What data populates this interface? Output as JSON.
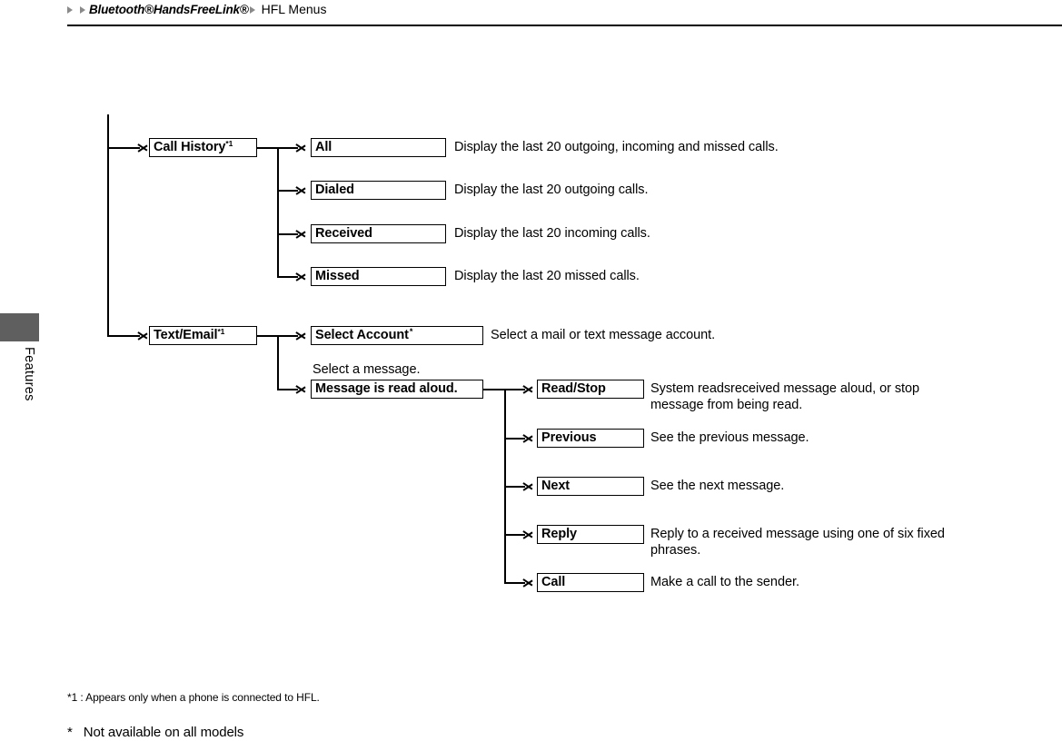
{
  "header": {
    "breadcrumb": {
      "item1": "Bluetooth®HandsFreeLink®",
      "item2": "HFL Menus"
    }
  },
  "sidebar": {
    "tab_label": "Features"
  },
  "flow": {
    "level1": [
      {
        "label": "Call History",
        "footnote": "*1"
      },
      {
        "label": "Text/Email",
        "footnote": "*1"
      }
    ],
    "call_history_children": [
      {
        "label": "All",
        "description": "Display the last 20 outgoing, incoming and missed calls."
      },
      {
        "label": "Dialed",
        "description": "Display the last 20 outgoing calls."
      },
      {
        "label": "Received",
        "description": "Display the last 20 incoming calls."
      },
      {
        "label": "Missed",
        "description": "Display the last 20 missed calls."
      }
    ],
    "text_email_children": [
      {
        "label": "Select Account",
        "footnote": "*",
        "description": "Select a mail or text message account."
      },
      {
        "label": "Message is read aloud",
        "trail": ".",
        "description": ""
      }
    ],
    "select_message_label": "Select a message.",
    "message_children": [
      {
        "label": "Read/Stop",
        "description": "System readsreceived message aloud, or stop\nmessage from being read."
      },
      {
        "label": "Previous",
        "description": "See the previous message."
      },
      {
        "label": "Next",
        "description": "See the next message."
      },
      {
        "label": "Reply",
        "description": "Reply to a received message using one of six fixed\nphrases."
      },
      {
        "label": "Call",
        "description": "Make a call to the sender."
      }
    ]
  },
  "footnotes": {
    "note1": "*1 :  Appears only when a phone is connected to HFL.",
    "note2_marker": "*",
    "note2_text": "Not available on all models"
  }
}
